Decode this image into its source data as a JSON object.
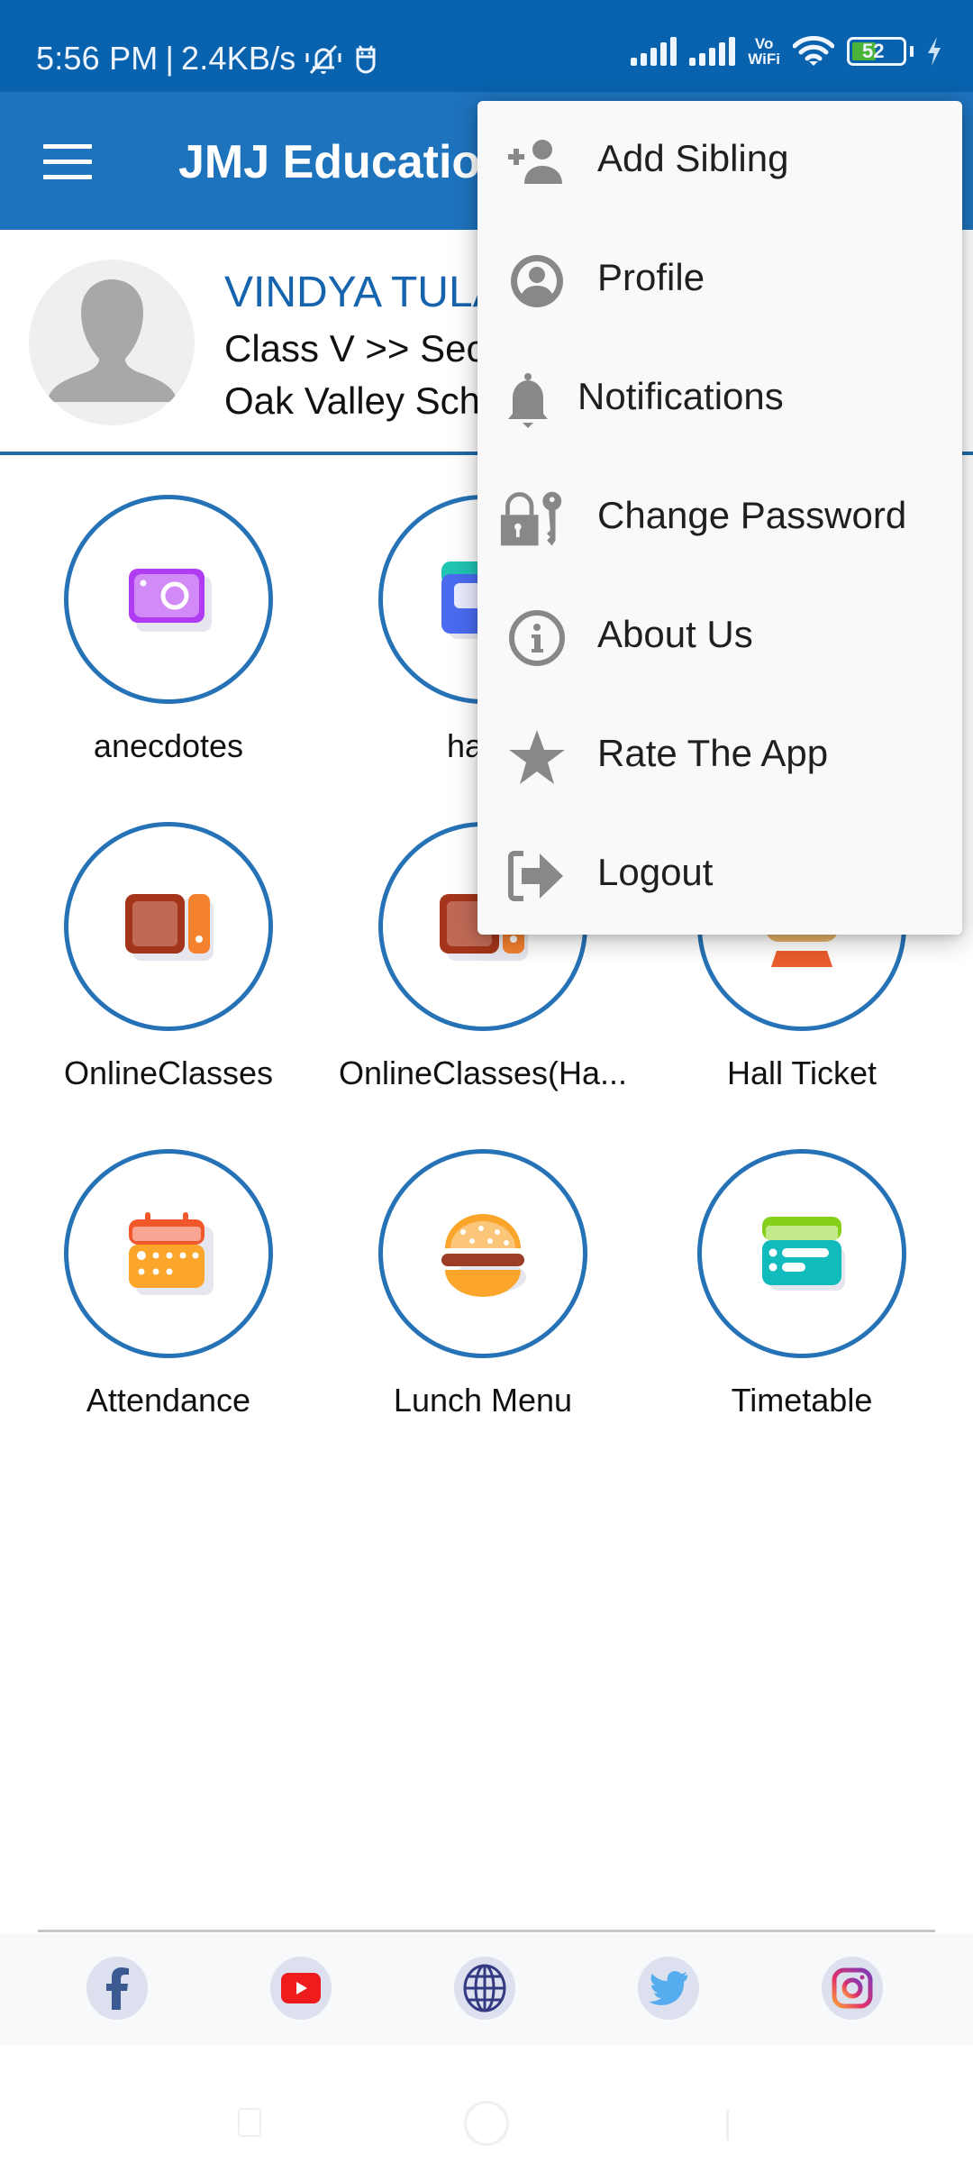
{
  "status_bar": {
    "time": "5:56 PM",
    "separator": "|",
    "network_speed": "2.4KB/s",
    "vowifi_top": "Vo",
    "vowifi_bottom": "WiFi",
    "battery_level": "52",
    "icons": [
      "bell-muted-icon",
      "android-debug-icon",
      "signal-icon",
      "signal-icon",
      "vowifi-icon",
      "wifi-icon",
      "battery-icon",
      "charging-icon"
    ]
  },
  "app_bar": {
    "title": "JMJ Education",
    "menu_icon": "hamburger-icon"
  },
  "profile": {
    "name": "VINDYA TULA",
    "class_section": "Class V >> Sec",
    "school": "Oak Valley Sch"
  },
  "grid": {
    "items": [
      {
        "label": "anecdotes",
        "icon": "camera-icon"
      },
      {
        "label": "hand",
        "icon": "handbook-icon"
      },
      {
        "label": "",
        "icon": "hidden"
      },
      {
        "label": "OnlineClasses",
        "icon": "online-classes-icon"
      },
      {
        "label": "OnlineClasses(Ha...",
        "icon": "online-classes-icon"
      },
      {
        "label": "Hall Ticket",
        "icon": "hall-ticket-icon"
      },
      {
        "label": "Attendance",
        "icon": "calendar-icon"
      },
      {
        "label": "Lunch Menu",
        "icon": "burger-icon"
      },
      {
        "label": "Timetable",
        "icon": "timetable-icon"
      }
    ]
  },
  "overflow_menu": {
    "items": [
      {
        "label": "Add Sibling",
        "icon": "add-person-icon"
      },
      {
        "label": "Profile",
        "icon": "account-circle-icon"
      },
      {
        "label": "Notifications",
        "icon": "bell-icon"
      },
      {
        "label": "Change Password",
        "icon": "lock-key-icon"
      },
      {
        "label": "About Us",
        "icon": "info-icon"
      },
      {
        "label": "Rate The App",
        "icon": "star-icon"
      },
      {
        "label": "Logout",
        "icon": "logout-icon"
      }
    ]
  },
  "social_links": [
    {
      "name": "facebook",
      "icon": "facebook-icon"
    },
    {
      "name": "youtube",
      "icon": "youtube-icon"
    },
    {
      "name": "website",
      "icon": "globe-icon"
    },
    {
      "name": "twitter",
      "icon": "twitter-icon"
    },
    {
      "name": "instagram",
      "icon": "instagram-icon"
    }
  ],
  "colors": {
    "status_bar": "#0962ad",
    "app_bar": "#1e73bd",
    "accent": "#2672b6",
    "student_name": "#1664ad",
    "menu_bg": "#f9f9f9",
    "menu_icon": "#888888"
  }
}
